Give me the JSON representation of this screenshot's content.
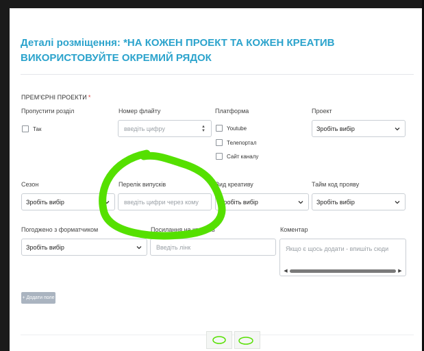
{
  "section": {
    "title": "Деталі розміщення: *НА КОЖЕН ПРОЕКТ ТА КОЖЕН КРЕАТИВ ВИКОРИСТОВУЙТЕ ОКРЕМИЙ РЯДОК"
  },
  "group": {
    "heading": "ПРЕМ'ЄРНІ ПРОЕКТИ",
    "required_mark": "*"
  },
  "fields": {
    "skip_section": {
      "label": "Пропустити розділ",
      "option": "Так"
    },
    "flight_number": {
      "label": "Номер флайту",
      "placeholder": "введіть цифру"
    },
    "platform": {
      "label": "Платформа",
      "options": [
        "Youtube",
        "Телепортал",
        "Сайт каналу"
      ]
    },
    "project": {
      "label": "Проект",
      "value": "Зробіть вибір"
    },
    "season": {
      "label": "Сезон",
      "value": "Зробіть вибір"
    },
    "episodes": {
      "label": "Перелік випусків",
      "placeholder": "введіть цифри через кому"
    },
    "creative_type": {
      "label": "Вид креативу",
      "value": "Зробіть вибір"
    },
    "timecode": {
      "label": "Тайм код прояву",
      "value": "Зробіть вибір"
    },
    "format_approval": {
      "label": "Погоджено з форматчиком",
      "value": "Зробіть вибір"
    },
    "creative_link": {
      "label": "Посилання на креатив",
      "placeholder": "Введіть лінк"
    },
    "comment": {
      "label": "Коментар",
      "placeholder": "Якщо є щось додати - впишіть сюди"
    }
  },
  "actions": {
    "add_field": "+ Додати поле"
  },
  "colors": {
    "title": "#2ba3cc",
    "highlight": "#55e000",
    "button": "#aab4c0"
  },
  "icons": [
    "chevron-down-icon",
    "spinner-arrows-icon",
    "checkbox-icon",
    "scroll-arrow-icon"
  ]
}
